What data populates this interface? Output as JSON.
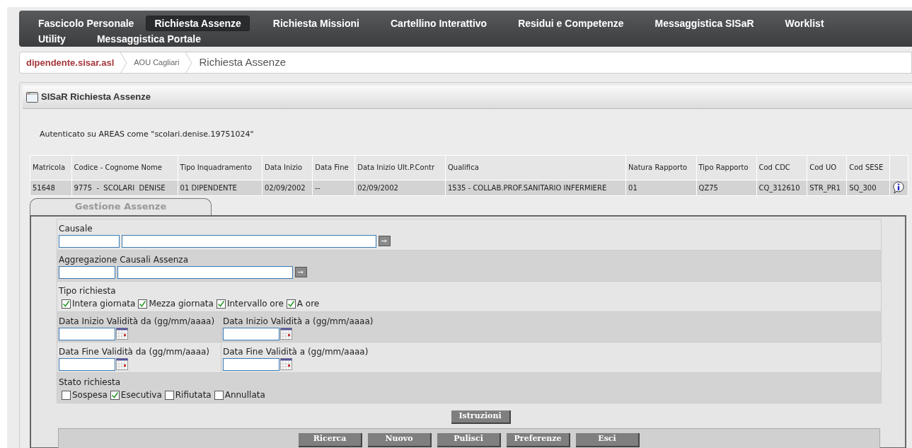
{
  "nav": {
    "items": [
      {
        "label": "Fascicolo Personale",
        "selected": false
      },
      {
        "label": "Richiesta Assenze",
        "selected": true
      },
      {
        "label": "Richiesta Missioni",
        "selected": false
      },
      {
        "label": "Cartellino Interattivo",
        "selected": false
      },
      {
        "label": "Residui e Competenze",
        "selected": false
      },
      {
        "label": "Messaggistica SISaR",
        "selected": false
      },
      {
        "label": "Worklist",
        "selected": false
      },
      {
        "label": "Utility",
        "selected": false
      },
      {
        "label": "Messaggistica Portale",
        "selected": false
      }
    ]
  },
  "breadcrumb": [
    {
      "kind": "link",
      "text": "dipendente.sisar.asl"
    },
    {
      "kind": "crumb",
      "text": "AOU Cagliari"
    },
    {
      "kind": "current",
      "text": "Richiesta Assenze"
    }
  ],
  "panel": {
    "title": "SISaR Richiesta Assenze"
  },
  "auth_text": "Autenticato su AREAS come \"scolari.denise.19751024\"",
  "table": {
    "columns": [
      "Matricola",
      "Codice - Cognome Nome",
      "Tipo Inquadramento",
      "Data Inizio",
      "Data Fine",
      "Data Inizio Ult.P.Contr",
      "Qualifica",
      "Natura Rapporto",
      "Tipo Rapporto",
      "Cod CDC",
      "Cod UO",
      "Cod SESE"
    ],
    "rows": [
      {
        "cells": [
          "51648",
          "9775  -  SCOLARI  DENISE",
          "01 DIPENDENTE",
          "02/09/2002",
          "--",
          "02/09/2002",
          "1535 - COLLAB.PROF.SANITARIO INFERMIERE",
          "01",
          "QZ75",
          "CQ_312610",
          "STR_PR1",
          "SQ_300"
        ]
      }
    ]
  },
  "tabs": [
    {
      "label": "Gestione Assenze",
      "selected": true
    }
  ],
  "form": {
    "causale": {
      "label": "Causale"
    },
    "aggregazione": {
      "label": "Aggregazione Causali Assenza"
    },
    "tipo_richiesta": {
      "label": "Tipo richiesta",
      "options": [
        {
          "label": "Intera giornata",
          "checked": true
        },
        {
          "label": "Mezza giornata",
          "checked": true
        },
        {
          "label": "Intervallo ore",
          "checked": true
        },
        {
          "label": "A ore",
          "checked": true
        }
      ]
    },
    "date_rows": [
      [
        "Data Inizio Validità da (gg/mm/aaaa)",
        "Data Inizio Validità a (gg/mm/aaaa)"
      ],
      [
        "Data Fine Validità da (gg/mm/aaaa)",
        "Data Fine Validità a (gg/mm/aaaa)"
      ]
    ],
    "stato_richiesta": {
      "label": "Stato richiesta",
      "options": [
        {
          "label": "Sospesa",
          "checked": false
        },
        {
          "label": "Esecutiva",
          "checked": true
        },
        {
          "label": "Rifiutata",
          "checked": false
        },
        {
          "label": "Annullata",
          "checked": false
        }
      ]
    },
    "instructions_button": "Istruzioni",
    "buttons": [
      "Ricerca",
      "Nuovo",
      "Pulisci",
      "Preferenze",
      "Esci"
    ]
  }
}
